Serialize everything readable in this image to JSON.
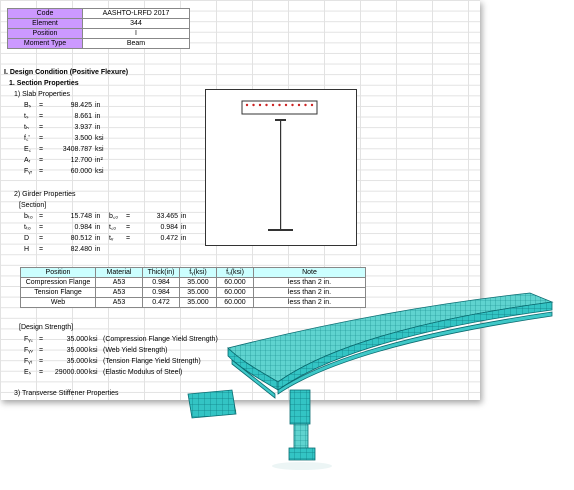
{
  "header": [
    {
      "key": "Code",
      "value": "AASHTO-LRFD 2017"
    },
    {
      "key": "Element",
      "value": "344"
    },
    {
      "key": "Position",
      "value": "I"
    },
    {
      "key": "Moment Type",
      "value": "Beam"
    }
  ],
  "section_title": "I. Design Condition (Positive Flexure)",
  "subsection_title": "1. Section Properties",
  "slab": {
    "title": "1)  Slab Properties",
    "rows": [
      {
        "sym": "Bₛ",
        "val": "98.425",
        "unit": "in"
      },
      {
        "sym": "tₛ",
        "val": "8.661",
        "unit": "in"
      },
      {
        "sym": "tₕ",
        "val": "3.937",
        "unit": "in"
      },
      {
        "sym": "f꜀'",
        "val": "3.500",
        "unit": "ksi"
      },
      {
        "sym": "E꜀",
        "val": "3408.787",
        "unit": "ksi"
      },
      {
        "sym": "Aᵣ",
        "val": "12.700",
        "unit": "in²"
      },
      {
        "sym": "Fᵧᵣ",
        "val": "60.000",
        "unit": "ksi"
      }
    ]
  },
  "girder": {
    "title": "2)  Girder Properties",
    "section_label": "[Section]",
    "left": [
      {
        "sym": "bₜₒ",
        "val": "15.748",
        "unit": "in"
      },
      {
        "sym": "tₜₒ",
        "val": "0.984",
        "unit": "in"
      },
      {
        "sym": "D",
        "val": "80.512",
        "unit": "in"
      },
      {
        "sym": "H",
        "val": "82.480",
        "unit": "in"
      }
    ],
    "right": [
      {
        "sym": "b꜀ₒ",
        "val": "33.465",
        "unit": "in"
      },
      {
        "sym": "t꜀ₒ",
        "val": "0.984",
        "unit": "in"
      },
      {
        "sym": "tᵥ",
        "val": "0.472",
        "unit": "in"
      }
    ]
  },
  "material_table": {
    "headers": [
      "Position",
      "Material",
      "Thick(in)",
      "fᵧ(ksi)",
      "fᵤ(ksi)",
      "Note"
    ],
    "rows": [
      [
        "Compression Flange",
        "A53",
        "0.984",
        "35.000",
        "60.000",
        "less than 2 in."
      ],
      [
        "Tension Flange",
        "A53",
        "0.984",
        "35.000",
        "60.000",
        "less than 2 in."
      ],
      [
        "Web",
        "A53",
        "0.472",
        "35.000",
        "60.000",
        "less than 2 in."
      ]
    ]
  },
  "design_strength": {
    "title": "[Design Strength]",
    "rows": [
      {
        "sym": "Fᵧ꜀",
        "val": "35.000",
        "unit": "ksi",
        "desc": "(Compression Flange Yield Strength)"
      },
      {
        "sym": "Fᵧᵥ",
        "val": "35.000",
        "unit": "ksi",
        "desc": "(Web Yield Strength)"
      },
      {
        "sym": "Fᵧₜ",
        "val": "35.000",
        "unit": "ksi",
        "desc": "(Tension Flange Yield Strength)"
      },
      {
        "sym": "Eₛ",
        "val": "29000.000",
        "unit": "ksi",
        "desc": "(Elastic Modulus of Steel)"
      }
    ]
  },
  "stiffener_title": "3)  Transverse Stiffener Properties",
  "colors": {
    "header_key": "#cc99ff",
    "table_header": "#ccffff",
    "bridge": "#2fbfbf",
    "rebar": "#cc2222"
  }
}
